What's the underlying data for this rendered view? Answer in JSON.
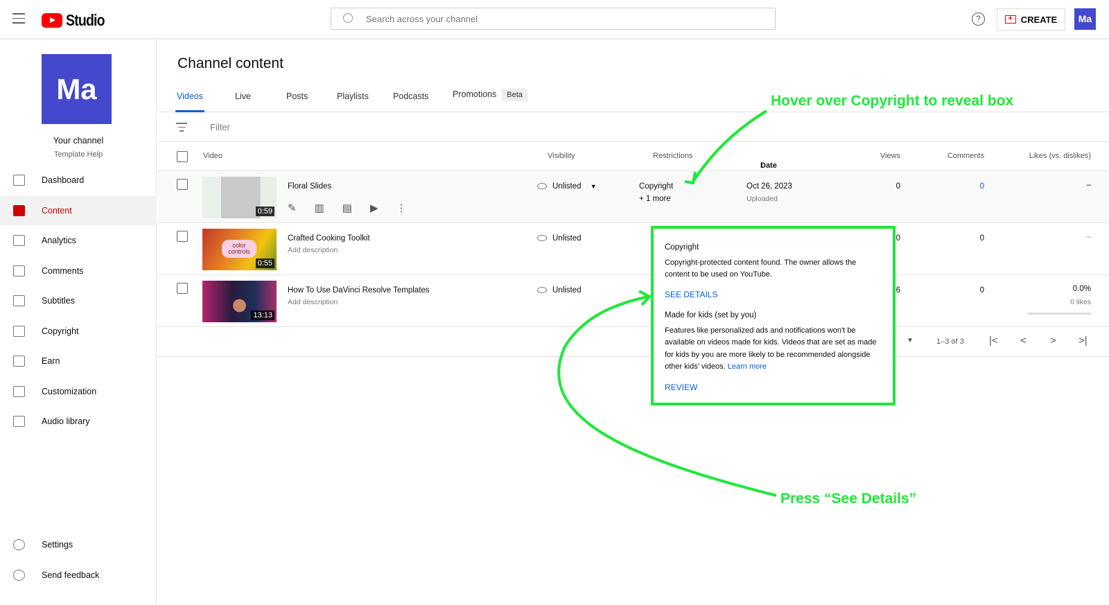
{
  "header": {
    "app_name": "Studio",
    "search_placeholder": "Search across your channel",
    "create_label": "CREATE",
    "avatar": "Ma",
    "help": "?"
  },
  "sidebar": {
    "avatar": "Ma",
    "channel_label": "Your channel",
    "channel_name": "Template Help",
    "items": [
      {
        "label": "Dashboard",
        "icon": "dashboard-icon"
      },
      {
        "label": "Content",
        "icon": "content-icon",
        "active": true
      },
      {
        "label": "Analytics",
        "icon": "analytics-icon"
      },
      {
        "label": "Comments",
        "icon": "comments-icon"
      },
      {
        "label": "Subtitles",
        "icon": "subtitles-icon"
      },
      {
        "label": "Copyright",
        "icon": "copyright-icon"
      },
      {
        "label": "Earn",
        "icon": "earn-icon"
      },
      {
        "label": "Customization",
        "icon": "customization-icon"
      },
      {
        "label": "Audio library",
        "icon": "audio-library-icon"
      }
    ],
    "bottom": [
      {
        "label": "Settings",
        "icon": "gear-icon"
      },
      {
        "label": "Send feedback",
        "icon": "feedback-icon"
      }
    ]
  },
  "main": {
    "title": "Channel content",
    "tabs": [
      "Videos",
      "Live",
      "Posts",
      "Playlists",
      "Podcasts",
      "Promotions"
    ],
    "beta": "Beta",
    "filter": "Filter",
    "columns": {
      "video": "Video",
      "visibility": "Visibility",
      "restrictions": "Restrictions",
      "date": "Date",
      "views": "Views",
      "comments": "Comments",
      "likes": "Likes (vs. dislikes)"
    },
    "rows": [
      {
        "title": "Floral Slides",
        "duration": "0:59",
        "visibility": "Unlisted",
        "restriction": "Copyright",
        "restriction_more": "+ 1 more",
        "date": "Oct 26, 2023",
        "date_status": "Uploaded",
        "views": "0",
        "comments": "0",
        "likes": "–"
      },
      {
        "title": "Crafted Cooking Toolkit",
        "description": "Add description",
        "duration": "0:55",
        "thumb_text": "color controls",
        "visibility": "Unlisted",
        "views": "0",
        "comments": "0",
        "likes": "–"
      },
      {
        "title": "How To Use DaVinci Resolve Templates",
        "description": "Add description",
        "duration": "13:13",
        "visibility": "Unlisted",
        "views": "6",
        "comments": "0",
        "likes": "0.0%",
        "likes_sub": "0 likes"
      }
    ],
    "pagination": "1–3 of 3"
  },
  "popup": {
    "title1": "Copyright",
    "text1": "Copyright-protected content found. The owner allows the content to be used on YouTube.",
    "link1": "SEE DETAILS",
    "title2": "Made for kids (set by you)",
    "text2": "Features like personalized ads and notifications won't be available on videos made for kids. Videos that are set as made for kids by you are more likely to be recommended alongside other kids' videos.",
    "learn_more": "Learn more",
    "link2": "REVIEW"
  },
  "annotations": {
    "top": "Hover over Copyright to reveal box",
    "bottom": "Press “See Details”",
    "color": "#1fe73a"
  }
}
